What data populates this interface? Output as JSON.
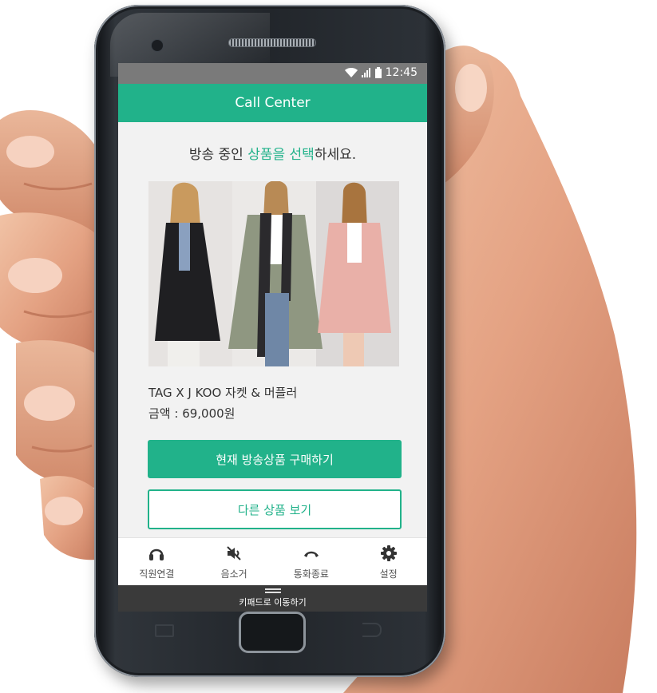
{
  "status_bar": {
    "time": "12:45"
  },
  "app_bar": {
    "title": "Call Center"
  },
  "headline": {
    "before": "방송 중인 ",
    "accent": "상품을 선택",
    "after": "하세요."
  },
  "product": {
    "name": "TAG  X  J KOO  자켓 & 머플러",
    "price": "금액 : 69,000원"
  },
  "actions": {
    "buy_label": "현재 방송상품 구매하기",
    "other_label": "다른 상품 보기"
  },
  "bottom_nav": {
    "items": [
      {
        "label": "직원연결",
        "icon": "headset-icon"
      },
      {
        "label": "음소거",
        "icon": "mute-icon"
      },
      {
        "label": "통화종료",
        "icon": "hang-up-icon"
      },
      {
        "label": "설정",
        "icon": "gear-icon"
      }
    ]
  },
  "keypad_bar": {
    "label": "키패드로 이동하기"
  },
  "colors": {
    "accent": "#21b28a",
    "status_bar": "#7a7a7a",
    "keypad_bar": "#3a3a3a"
  }
}
